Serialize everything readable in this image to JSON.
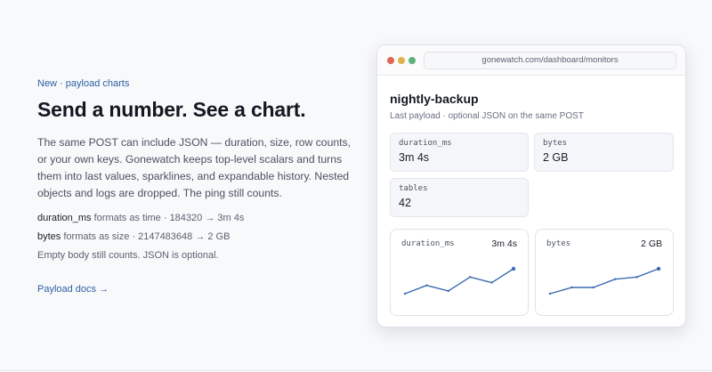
{
  "hero": {
    "eyebrow": "New · payload charts",
    "headline": "Send a number. See a chart.",
    "description": "The same POST can include JSON — duration, size, row counts, or your own keys. Gonewatch keeps top-level scalars and turns them into last values, sparklines, and expandable history. Nested objects and logs are dropped. The ping still counts.",
    "facts": [
      {
        "key": "duration_ms",
        "text": " formats as time · 184320 → 3m 4s"
      },
      {
        "key": "bytes",
        "text": " formats as size · 2147483648 → 2 GB"
      }
    ],
    "note": "Empty body still counts. JSON is optional.",
    "link": "Payload docs →"
  },
  "window": {
    "url": "gonewatch.com/dashboard/monitors",
    "monitor_name": "nightly-backup",
    "monitor_sub": "Last payload · optional JSON on the same POST",
    "stats": [
      {
        "label": "duration_ms",
        "value": "3m 4s"
      },
      {
        "label": "bytes",
        "value": "2 GB"
      },
      {
        "label": "tables",
        "value": "42"
      }
    ],
    "sparklines": [
      {
        "label": "duration_ms",
        "value": "3m 4s",
        "points": [
          2,
          5,
          3,
          8,
          6,
          11
        ],
        "color": "#3a6db0"
      },
      {
        "label": "bytes",
        "value": "2 GB",
        "points": [
          2,
          5,
          5,
          9,
          10,
          14
        ],
        "color": "#3a6db0"
      }
    ]
  }
}
